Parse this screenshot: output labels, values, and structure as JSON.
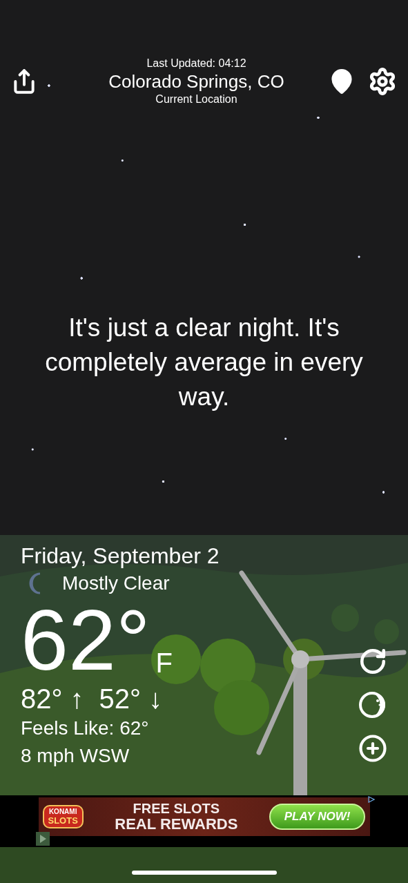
{
  "header": {
    "last_updated": "Last Updated: 04:12",
    "city": "Colorado Springs, CO",
    "location_label": "Current Location"
  },
  "message": "It's just a clear night. It's completely average in every way.",
  "conditions": {
    "date": "Friday, September 2",
    "summary": "Mostly Clear",
    "temperature": "62°",
    "unit": "F",
    "high": "82° ↑",
    "low": "52° ↓",
    "feels_like": "Feels Like: 62°",
    "wind": "8 mph WSW"
  },
  "ad": {
    "brand_top": "KONAMI",
    "brand_bottom": "SLOTS",
    "headline_1": "FREE SLOTS",
    "headline_2": "REAL REWARDS",
    "button": "PLAY NOW!"
  }
}
